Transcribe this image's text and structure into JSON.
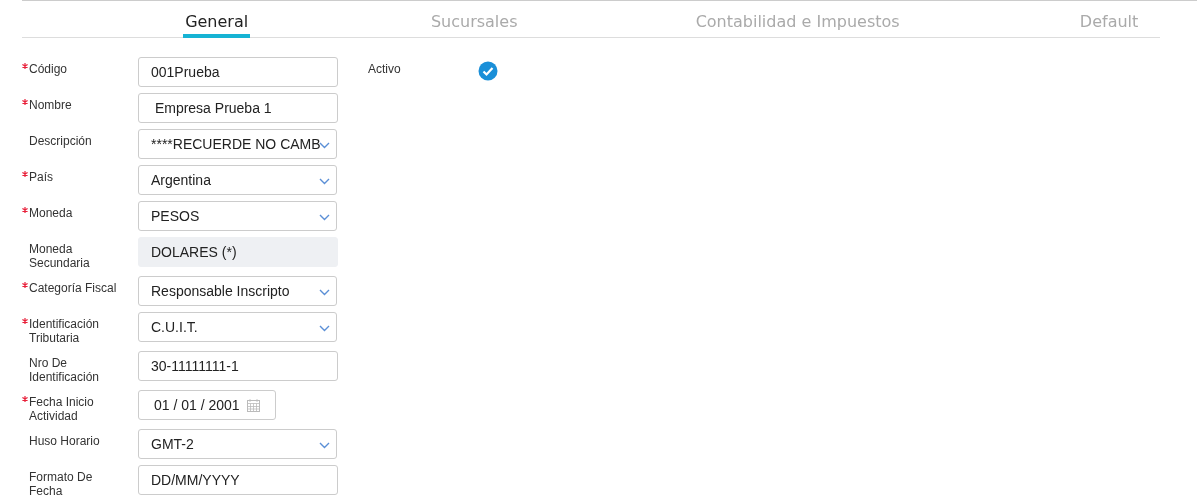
{
  "tabs": [
    {
      "label": "General",
      "selected": true
    },
    {
      "label": "Sucursales",
      "selected": false
    },
    {
      "label": "Contabilidad e Impuestos",
      "selected": false
    },
    {
      "label": "Default",
      "selected": false
    }
  ],
  "fields": [
    {
      "label": "Código",
      "required": true,
      "kind": "text",
      "value": "001Prueba"
    },
    {
      "label": "Nombre",
      "required": true,
      "kind": "text",
      "value": " Empresa Prueba 1"
    },
    {
      "label": "Descripción",
      "required": false,
      "kind": "select",
      "value": "****RECUERDE NO CAMB"
    },
    {
      "label": "País",
      "required": true,
      "kind": "select",
      "value": "Argentina"
    },
    {
      "label": "Moneda",
      "required": true,
      "kind": "select",
      "value": "PESOS"
    },
    {
      "label": "Moneda Secundaria",
      "required": false,
      "kind": "readonly",
      "value": "DOLARES (*)"
    },
    {
      "label": "Categoría Fiscal",
      "required": true,
      "kind": "select",
      "value": "Responsable Inscripto"
    },
    {
      "label": "Identificación Tributaria",
      "required": true,
      "kind": "select",
      "value": "C.U.I.T."
    },
    {
      "label": "Nro De Identificación",
      "required": false,
      "kind": "text",
      "value": "30-11111111-1"
    },
    {
      "label": "Fecha Inicio Actividad",
      "required": true,
      "kind": "date",
      "value": "01 / 01 / 2001"
    },
    {
      "label": "Huso Horario",
      "required": false,
      "kind": "select",
      "value": "GMT-2"
    },
    {
      "label": "Formato De Fecha",
      "required": false,
      "kind": "text",
      "value": "DD/MM/YYYY"
    }
  ],
  "active": {
    "label": "Activo",
    "checked": true
  }
}
